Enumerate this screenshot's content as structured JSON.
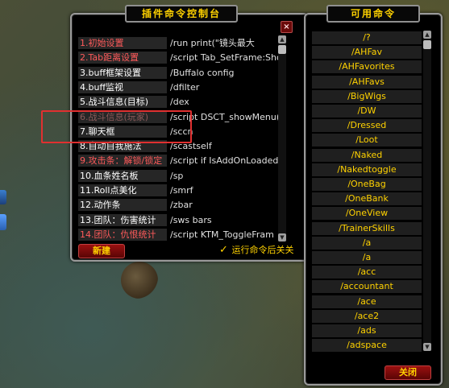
{
  "console": {
    "title": "插件命令控制台",
    "close_label": "×",
    "rows": [
      {
        "name": "1.初始设置",
        "value": "/run print(\"镜头最大",
        "color": "red"
      },
      {
        "name": "2.Tab距离设置",
        "value": "/script Tab_SetFrame:Sho",
        "color": "red"
      },
      {
        "name": "3.buff框架设置",
        "value": "/Buffalo config",
        "color": "white"
      },
      {
        "name": "4.buff监视",
        "value": "/dfilter",
        "color": "white"
      },
      {
        "name": "5.战斗信息(目标)",
        "value": "/dex",
        "color": "white"
      },
      {
        "name": "6.战斗信息(玩家)",
        "value": "/script DSCT_showMenu()",
        "color": "dim"
      },
      {
        "name": "7.聊天框",
        "value": "/sccn",
        "color": "white"
      },
      {
        "name": "8.自动自我施法",
        "value": "/scastself",
        "color": "white"
      },
      {
        "name": "9.攻击条：解锁/锁定",
        "value": "/script if IsAddOnLoaded",
        "color": "red"
      },
      {
        "name": "10.血条姓名板",
        "value": "/sp",
        "color": "white"
      },
      {
        "name": "11.Roll点美化",
        "value": "/smrf",
        "color": "white"
      },
      {
        "name": "12.动作条",
        "value": "/zbar",
        "color": "white"
      },
      {
        "name": "13.团队：伤害统计",
        "value": "/sws bars",
        "color": "white"
      },
      {
        "name": "14.团队：仇恨统计",
        "value": "/script KTM_ToggleFram",
        "color": "red"
      }
    ],
    "new_button": "新建",
    "checkbox_mark": "✓",
    "checkbox_label": "运行命令后关关"
  },
  "commands": {
    "title": "可用命令",
    "items": [
      "/?",
      "/AHFav",
      "/AHFavorites",
      "/AHFavs",
      "/BigWigs",
      "/DW",
      "/Dressed",
      "/Loot",
      "/Naked",
      "/Nakedtoggle",
      "/OneBag",
      "/OneBank",
      "/OneView",
      "/TrainerSkills",
      "/a",
      "/a",
      "/acc",
      "/accountant",
      "/ace",
      "/ace2",
      "/ads",
      "/adspace"
    ],
    "close_button": "关闭"
  },
  "scroll": {
    "up": "▲",
    "down": "▼"
  },
  "colors": {
    "title": "#ffd200",
    "highlight": "#e03030",
    "button_bg": "#9a1010"
  }
}
